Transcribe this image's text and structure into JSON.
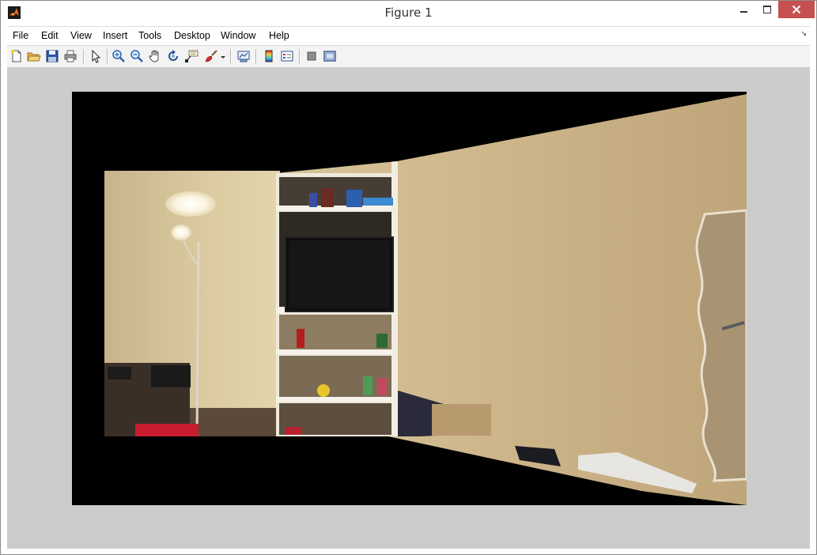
{
  "window": {
    "title": "Figure 1"
  },
  "menu": [
    {
      "label": "File"
    },
    {
      "label": "Edit"
    },
    {
      "label": "View"
    },
    {
      "label": "Insert"
    },
    {
      "label": "Tools"
    },
    {
      "label": "Desktop"
    },
    {
      "label": "Window"
    },
    {
      "label": "Help"
    }
  ],
  "toolbar": {
    "buttons": [
      {
        "icon": "new-figure-icon"
      },
      {
        "icon": "open-file-icon"
      },
      {
        "icon": "save-icon"
      },
      {
        "icon": "print-icon"
      },
      {
        "icon": "edit-plot-arrow-icon"
      },
      {
        "icon": "zoom-in-icon"
      },
      {
        "icon": "zoom-out-icon"
      },
      {
        "icon": "pan-hand-icon"
      },
      {
        "icon": "rotate-3d-icon"
      },
      {
        "icon": "data-cursor-icon"
      },
      {
        "icon": "brush-icon"
      },
      {
        "icon": "link-plot-icon"
      },
      {
        "icon": "insert-colorbar-icon"
      },
      {
        "icon": "insert-legend-icon"
      },
      {
        "icon": "hide-plot-tools-icon"
      },
      {
        "icon": "show-plot-tools-icon"
      }
    ]
  },
  "colors": {
    "figure_background": "#cccccc",
    "axes_background": "#000000",
    "close_button": "#c75050"
  }
}
